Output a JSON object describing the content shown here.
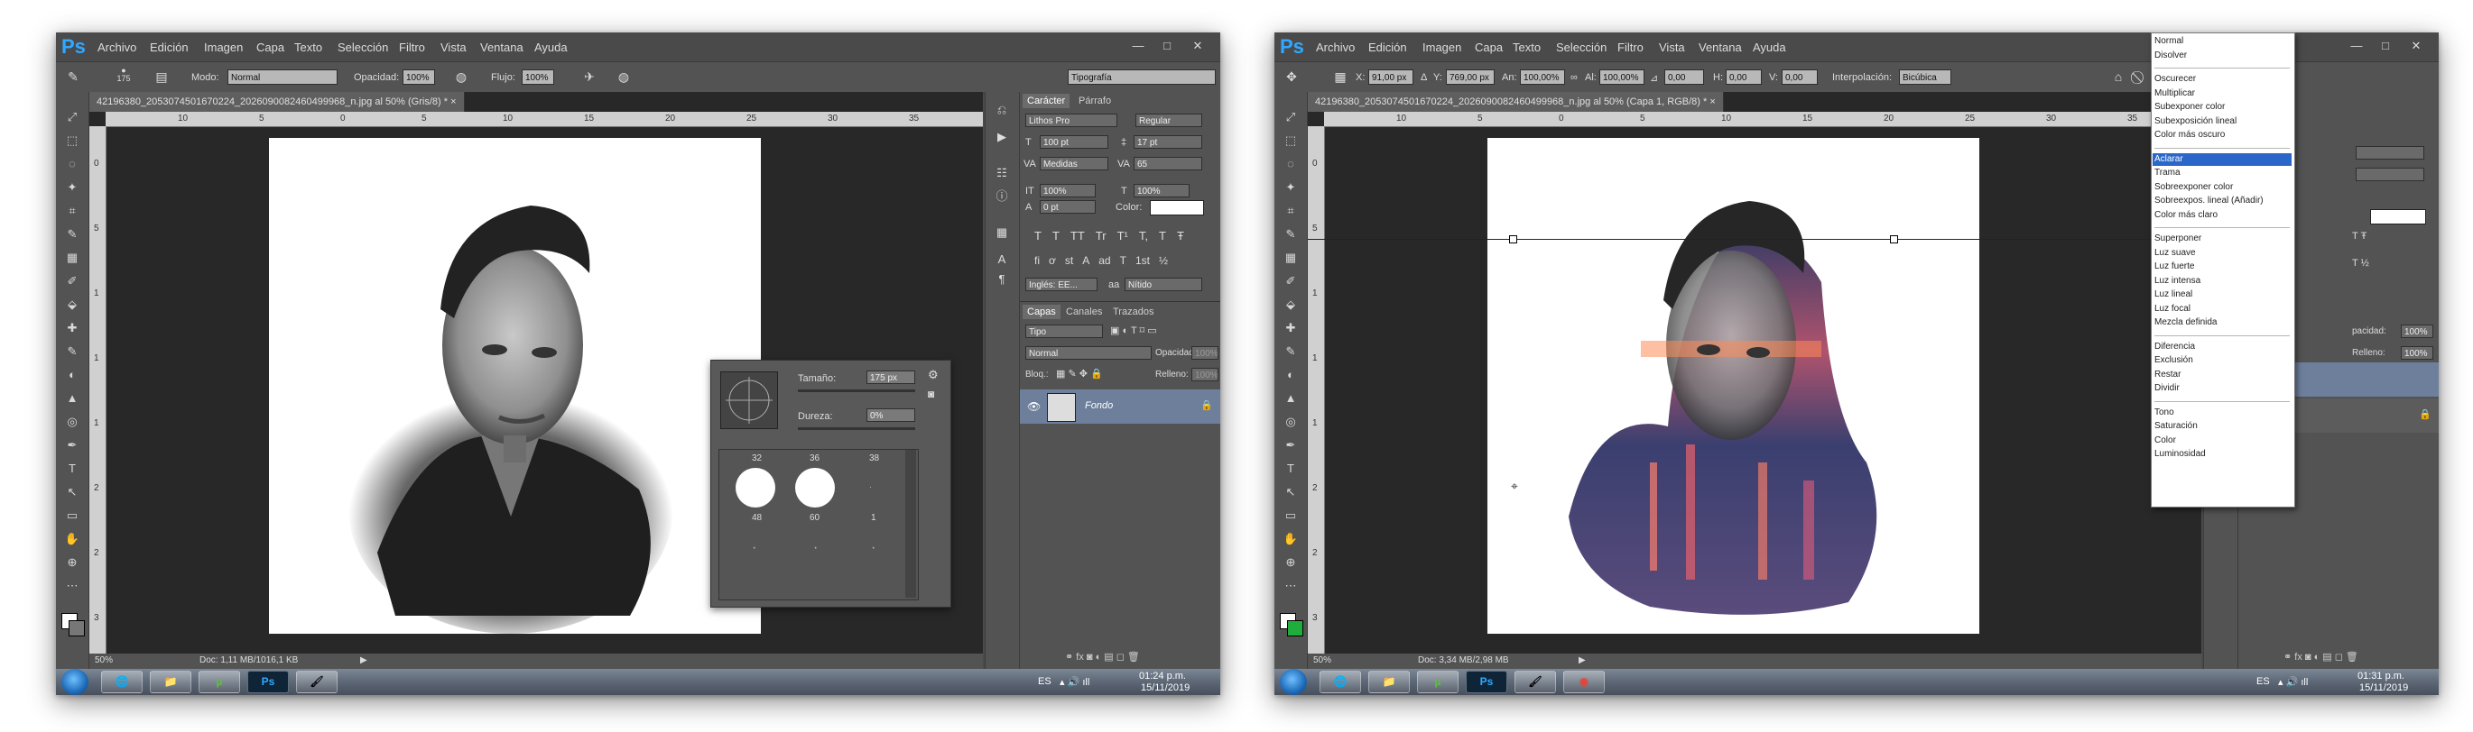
{
  "menu": [
    "Archivo",
    "Edición",
    "Imagen",
    "Capa",
    "Texto",
    "Selección",
    "Filtro",
    "Vista",
    "Ventana",
    "Ayuda"
  ],
  "logo": "Ps",
  "window_controls": [
    "—",
    "□",
    "✕"
  ],
  "left": {
    "options": {
      "brush_size": "175",
      "mode_label": "Modo:",
      "mode_value": "Normal",
      "opacity_label": "Opacidad:",
      "opacity_value": "100%",
      "flow_label": "Flujo:",
      "flow_value": "100%",
      "workspace": "Tipografía"
    },
    "doc_tab": "42196380_2053074501670224_2026090082460499968_n.jpg al 50% (Gris/8) * ×",
    "ruler_numbers": [
      "10",
      "5",
      "0",
      "5",
      "10",
      "15",
      "20",
      "25",
      "30",
      "35",
      "40"
    ],
    "ruler_v_numbers": [
      "0",
      "5",
      "1",
      "1",
      "1",
      "2",
      "2",
      "3"
    ],
    "status_zoom": "50%",
    "status_doc": "Doc: 1,11 MB/1016,1 KB",
    "brush_popup": {
      "size_label": "Tamaño:",
      "size_value": "175 px",
      "hardness_label": "Dureza:",
      "hardness_value": "0%",
      "presets_top": [
        "32",
        "36",
        "38"
      ],
      "presets_mid": [
        "48",
        "60",
        "1"
      ]
    },
    "character_panel": {
      "tabs": [
        "Carácter",
        "Párrafo"
      ],
      "font_family": "Lithos Pro",
      "font_style": "Regular",
      "font_size": "100 pt",
      "leading": "17 pt",
      "kerning": "Medidas",
      "tracking": "65",
      "vertical_scale": "100%",
      "horizontal_scale": "100%",
      "baseline": "0 pt",
      "color_label": "Color:",
      "language": "Inglés: EE...",
      "antialias_label": "aa",
      "antialias": "Nítido",
      "type_buttons": [
        "T",
        "T",
        "TT",
        "Tr",
        "T¹",
        "T,",
        "T",
        "Ŧ"
      ],
      "opentype_buttons": [
        "fi",
        "ơ",
        "st",
        "A",
        "ad",
        "T",
        "1st",
        "½"
      ]
    },
    "layers_panel": {
      "tabs": [
        "Capas",
        "Canales",
        "Trazados"
      ],
      "filter": "Tipo",
      "blend": "Normal",
      "opacity_label": "Opacidad:",
      "opacity": "100%",
      "lock_label": "Bloq.:",
      "fill_label": "Relleno:",
      "fill": "100%",
      "layer_name": "Fondo"
    },
    "taskbar": {
      "lang": "ES",
      "time": "01:24 p.m.",
      "date": "15/11/2019",
      "apps": [
        "🌐",
        "📁",
        "µ",
        "Ps",
        "🖌"
      ]
    }
  },
  "right": {
    "options": {
      "x_label": "X:",
      "x_value": "91,00 px",
      "y_label": "Y:",
      "y_value": "769,00 px",
      "w_label": "An:",
      "w_value": "100,00%",
      "h_label": "Al:",
      "h_value": "100,00%",
      "angle_value": "0,00",
      "h_skew_label": "H:",
      "h_skew": "0,00",
      "v_skew_label": "V:",
      "v_skew": "0,00",
      "interp_label": "Interpolación:",
      "interp_value": "Bicúbica"
    },
    "doc_tab": "42196380_2053074501670224_2026090082460499968_n.jpg al 50% (Capa 1, RGB/8) * ×",
    "status_zoom": "50%",
    "status_doc": "Doc: 3,34 MB/2,98 MB",
    "blend_modes": [
      [
        "Normal",
        "Disolver"
      ],
      [
        "Oscurecer",
        "Multiplicar",
        "Subexponer color",
        "Subexposición lineal",
        "Color más oscuro"
      ],
      [
        "Aclarar",
        "Trama",
        "Sobreexponer color",
        "Sobreexpos. lineal (Añadir)",
        "Color más claro"
      ],
      [
        "Superponer",
        "Luz suave",
        "Luz fuerte",
        "Luz intensa",
        "Luz lineal",
        "Luz focal",
        "Mezcla definida"
      ],
      [
        "Diferencia",
        "Exclusión",
        "Restar",
        "Dividir"
      ],
      [
        "Tono",
        "Saturación",
        "Color",
        "Luminosidad"
      ]
    ],
    "blend_selected": "Aclarar",
    "layers_partial": {
      "opacity_label": "pacidad:",
      "opacity": "100%",
      "fill_label": "Relleno:",
      "fill": "100%"
    },
    "taskbar": {
      "lang": "ES",
      "time": "01:31 p.m.",
      "date": "15/11/2019",
      "apps": [
        "🌐",
        "📁",
        "µ",
        "Ps",
        "🖌",
        "◉"
      ]
    }
  },
  "tools": [
    "⤢",
    "⬚",
    "◌",
    "✦",
    "⌗",
    "✎",
    "▦",
    "✐",
    "⬙",
    "✚",
    "✎",
    "◐",
    "▲",
    "◎",
    "✒",
    "T",
    "↖",
    "▭",
    "✋",
    "⊕",
    "⋯"
  ]
}
